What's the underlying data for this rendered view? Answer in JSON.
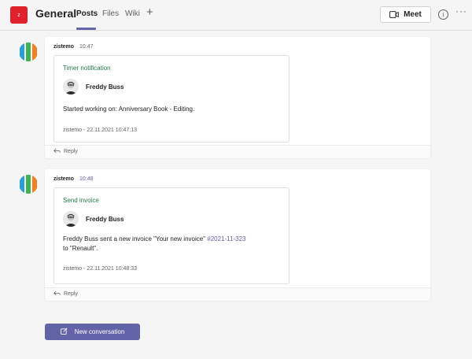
{
  "header": {
    "team_logo_letter": "z",
    "channel_name": "General",
    "tabs": [
      {
        "label": "Posts"
      },
      {
        "label": "Files"
      },
      {
        "label": "Wiki"
      }
    ],
    "add_tab_symbol": "+",
    "meet_label": "Meet",
    "info_symbol": "i",
    "more_symbol": "···"
  },
  "posts": [
    {
      "author": "zistemo",
      "time": "10:47",
      "card": {
        "title": "Timer notification",
        "person": "Freddy Buss",
        "text": "Started working on: Anniversary Book - Editing.",
        "footer": "zistemo - 22.11.2021 10:47:13"
      },
      "reply_label": "Reply"
    },
    {
      "author": "zistemo",
      "time": "10:48",
      "card": {
        "title": "Send invoice",
        "person": "Freddy Buss",
        "text_before": "Freddy Buss sent a new invoice \"Your new invoice\" ",
        "invoice_ref": "#2021-11-323",
        "text_after": "to \"Renault\".",
        "footer": "zistemo - 22.11.2021 10:48:33"
      },
      "reply_label": "Reply"
    }
  ],
  "new_conversation_label": "New conversation",
  "colors": {
    "accent": "#6264a7",
    "card_title": "#237b4b",
    "team_logo": "#e0202a"
  }
}
